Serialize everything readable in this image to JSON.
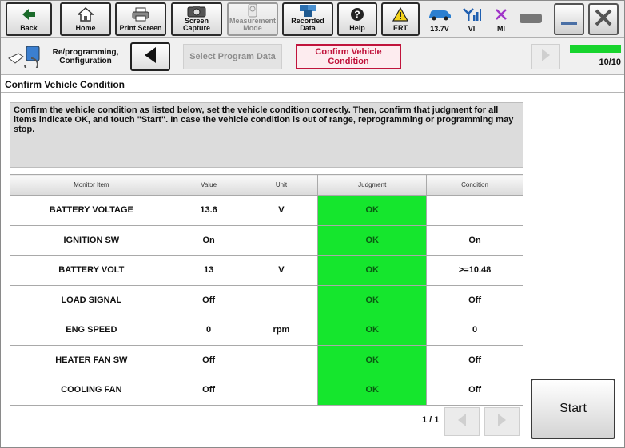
{
  "toolbar": {
    "back": "Back",
    "home": "Home",
    "print_screen": "Print Screen",
    "screen_capture": "Screen Capture",
    "measurement_mode": "Measurement Mode",
    "recorded_data": "Recorded Data",
    "help": "Help",
    "ert": "ERT",
    "battery_voltage": "13.7V",
    "vi": "VI",
    "mi": "MI"
  },
  "nav": {
    "section_label": "Re/programming, Configuration",
    "step_prev": "Select Program Data",
    "step_current": "Confirm Vehicle Condition",
    "progress": "10/10",
    "progress_fraction": 1.0
  },
  "page": {
    "title": "Confirm Vehicle Condition",
    "instruction": "Confirm the vehicle condition as listed below, set the vehicle condition correctly. Then, confirm that judgment for all items indicate OK, and touch \"Start\". In case the vehicle condition is out of range, reprogramming or programming may stop."
  },
  "table": {
    "headers": [
      "Monitor Item",
      "Value",
      "Unit",
      "Judgment",
      "Condition"
    ],
    "rows": [
      {
        "item": "BATTERY VOLTAGE",
        "value": "13.6",
        "unit": "V",
        "judgment": "OK",
        "condition": ""
      },
      {
        "item": "IGNITION SW",
        "value": "On",
        "unit": "",
        "judgment": "OK",
        "condition": "On"
      },
      {
        "item": "BATTERY VOLT",
        "value": "13",
        "unit": "V",
        "judgment": "OK",
        "condition": ">=10.48"
      },
      {
        "item": "LOAD SIGNAL",
        "value": "Off",
        "unit": "",
        "judgment": "OK",
        "condition": "Off"
      },
      {
        "item": "ENG SPEED",
        "value": "0",
        "unit": "rpm",
        "judgment": "OK",
        "condition": "0"
      },
      {
        "item": "HEATER FAN SW",
        "value": "Off",
        "unit": "",
        "judgment": "OK",
        "condition": "Off"
      },
      {
        "item": "COOLING FAN",
        "value": "Off",
        "unit": "",
        "judgment": "OK",
        "condition": "Off"
      }
    ]
  },
  "pager": {
    "text": "1 / 1"
  },
  "start_label": "Start",
  "colors": {
    "ok_green": "#15e62d",
    "accent_red": "#c0143c",
    "progress_green": "#17d42d"
  }
}
